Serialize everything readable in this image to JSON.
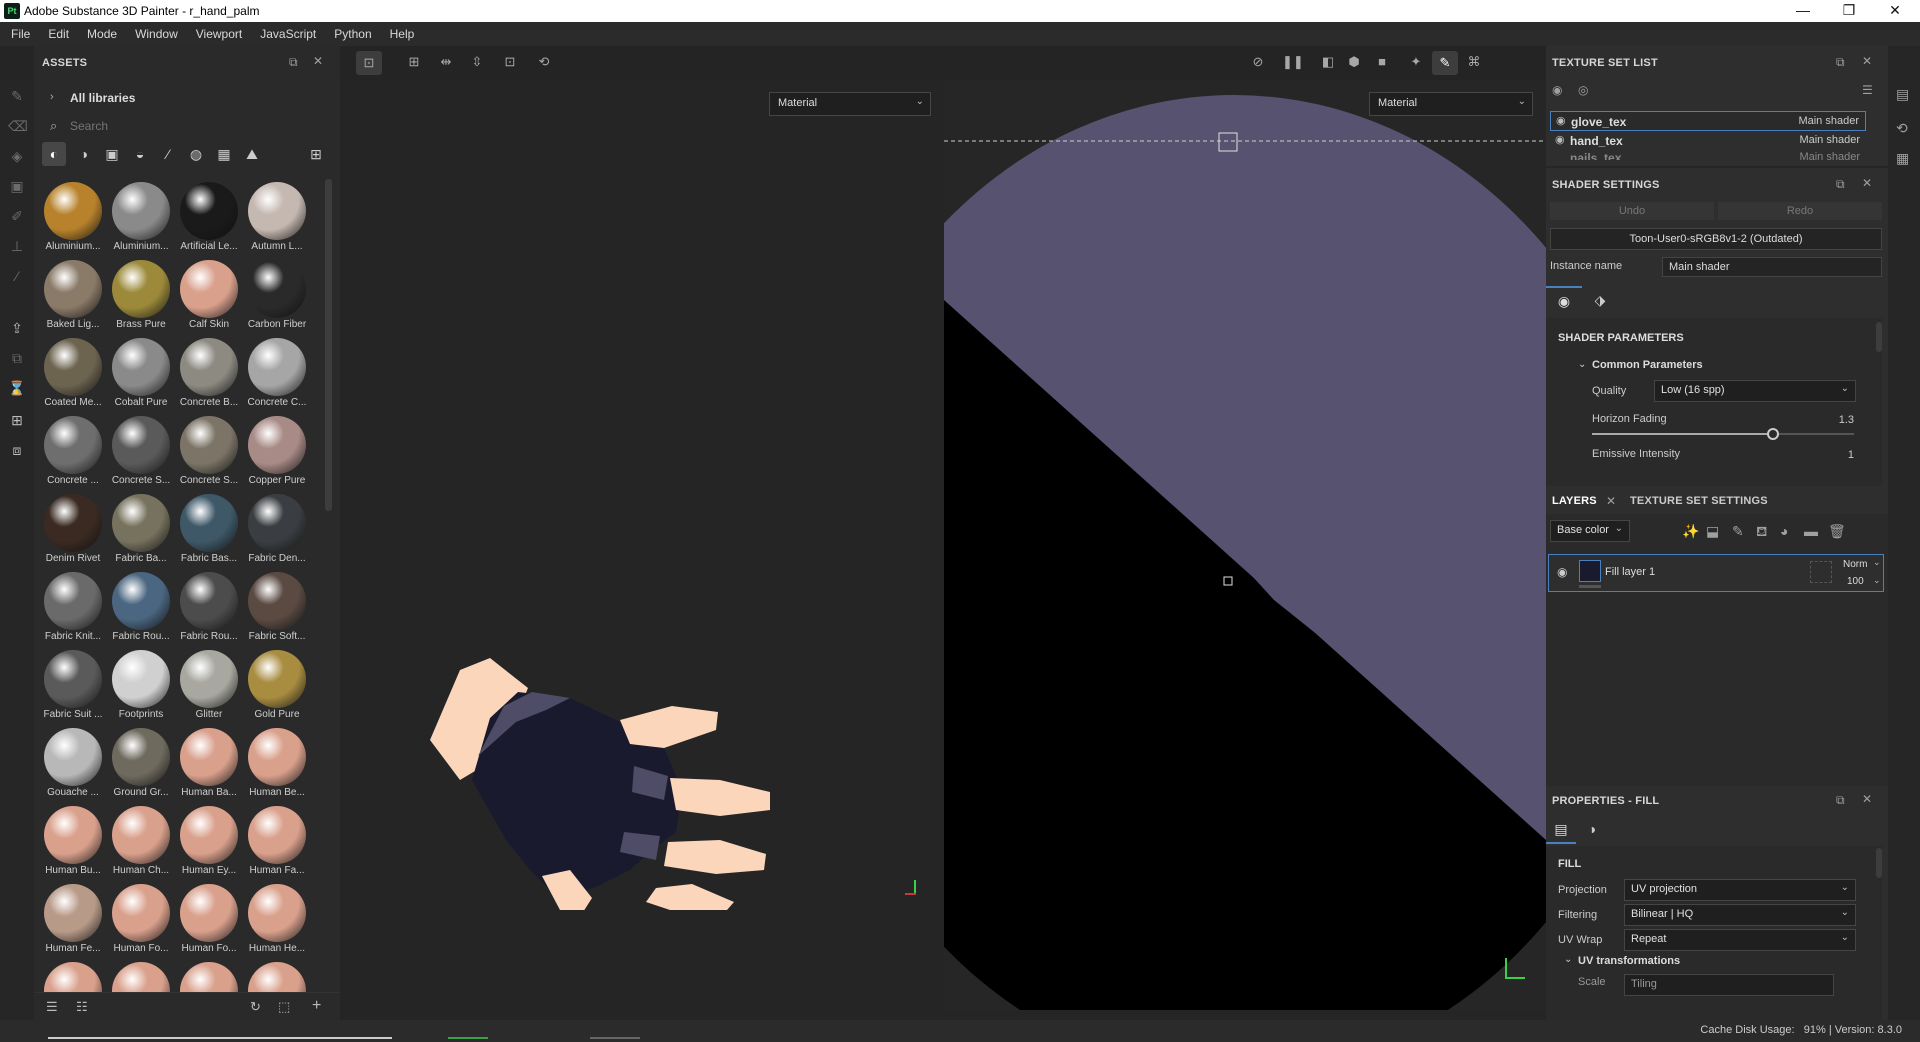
{
  "window": {
    "title": "Adobe Substance 3D Painter - r_hand_palm",
    "logo": "Pt",
    "minimize": "—",
    "maximize": "❐",
    "close": "✕"
  },
  "menu": [
    "File",
    "Edit",
    "Mode",
    "Window",
    "Viewport",
    "JavaScript",
    "Python",
    "Help"
  ],
  "assets": {
    "title": "ASSETS",
    "library": "All libraries",
    "search_placeholder": "Search",
    "items": [
      {
        "name": "Aluminium...",
        "color": "#b8822c"
      },
      {
        "name": "Aluminium...",
        "color": "#8a8a8a"
      },
      {
        "name": "Artificial Le...",
        "color": "#1a1a1a"
      },
      {
        "name": "Autumn L...",
        "color": "#c5b8b0"
      },
      {
        "name": "Baked Lig...",
        "color": "#8a7a68"
      },
      {
        "name": "Brass Pure",
        "color": "#9c8a3a"
      },
      {
        "name": "Calf Skin",
        "color": "#d9a08c"
      },
      {
        "name": "Carbon Fiber",
        "color": "#2a2a2a"
      },
      {
        "name": "Coated Me...",
        "color": "#6d6450"
      },
      {
        "name": "Cobalt Pure",
        "color": "#8a8a8a"
      },
      {
        "name": "Concrete B...",
        "color": "#8d8a82"
      },
      {
        "name": "Concrete C...",
        "color": "#a6a6a6"
      },
      {
        "name": "Concrete ...",
        "color": "#6e6e6e"
      },
      {
        "name": "Concrete S...",
        "color": "#5a5a5a"
      },
      {
        "name": "Concrete S...",
        "color": "#7c7466"
      },
      {
        "name": "Copper Pure",
        "color": "#a88a86"
      },
      {
        "name": "Denim Rivet",
        "color": "#3a2a22"
      },
      {
        "name": "Fabric Ba...",
        "color": "#77725e"
      },
      {
        "name": "Fabric Bas...",
        "color": "#3e5868"
      },
      {
        "name": "Fabric Den...",
        "color": "#3a3e42"
      },
      {
        "name": "Fabric Knit...",
        "color": "#6a6a6a"
      },
      {
        "name": "Fabric Rou...",
        "color": "#4a6680"
      },
      {
        "name": "Fabric Rou...",
        "color": "#4c4c4c"
      },
      {
        "name": "Fabric Soft...",
        "color": "#5a4a42"
      },
      {
        "name": "Fabric Suit ...",
        "color": "#5a5a5a"
      },
      {
        "name": "Footprints",
        "color": "#d0d0d0"
      },
      {
        "name": "Glitter",
        "color": "#a8a8a0"
      },
      {
        "name": "Gold Pure",
        "color": "#a88c40"
      },
      {
        "name": "Gouache ...",
        "color": "#b8b8b8"
      },
      {
        "name": "Ground Gr...",
        "color": "#6e6a5e"
      },
      {
        "name": "Human Ba...",
        "color": "#d9a08c"
      },
      {
        "name": "Human Be...",
        "color": "#d9a08c"
      },
      {
        "name": "Human Bu...",
        "color": "#d9a08c"
      },
      {
        "name": "Human Ch...",
        "color": "#d9a08c"
      },
      {
        "name": "Human Ey...",
        "color": "#d9a08c"
      },
      {
        "name": "Human Fa...",
        "color": "#d9a08c"
      },
      {
        "name": "Human Fe...",
        "color": "#b89a88"
      },
      {
        "name": "Human Fo...",
        "color": "#d9a08c"
      },
      {
        "name": "Human Fo...",
        "color": "#d9a08c"
      },
      {
        "name": "Human He...",
        "color": "#d9a08c"
      },
      {
        "name": "",
        "color": "#d9a08c"
      },
      {
        "name": "",
        "color": "#d9a08c"
      },
      {
        "name": "",
        "color": "#d9a08c"
      },
      {
        "name": "",
        "color": "#d9a08c"
      }
    ]
  },
  "viewport": {
    "left_channel": "Material",
    "right_channel": "Material",
    "model_colors": {
      "glove": "#1a1a2e",
      "skin": "#fbd6bb",
      "glove_edge": "#4e4c66",
      "uv_bg": "#575270"
    }
  },
  "texture_set_list": {
    "title": "TEXTURE SET LIST",
    "sets": [
      {
        "name": "glove_tex",
        "shader": "Main shader"
      },
      {
        "name": "hand_tex",
        "shader": "Main shader"
      },
      {
        "name": "nails_tex",
        "shader": "Main shader"
      }
    ]
  },
  "shader_settings": {
    "title": "SHADER SETTINGS",
    "undo": "Undo",
    "redo": "Redo",
    "shader": "Toon-User0-sRGB8v1-2 (Outdated)",
    "instance_label": "Instance name",
    "instance_value": "Main shader",
    "params_title": "SHADER PARAMETERS",
    "common_title": "Common Parameters",
    "quality_label": "Quality",
    "quality_value": "Low (16 spp)",
    "horizon_label": "Horizon Fading",
    "horizon_value": "1.3",
    "horizon_fraction": 0.69,
    "emissive_label": "Emissive Intensity",
    "emissive_value": "1"
  },
  "layers": {
    "tab_layers": "LAYERS",
    "tab_tss": "TEXTURE SET SETTINGS",
    "channel": "Base color",
    "layer_name": "Fill layer 1",
    "blend": "Norm",
    "opacity": "100"
  },
  "properties": {
    "title": "PROPERTIES - FILL",
    "section": "FILL",
    "projection_label": "Projection",
    "projection_value": "UV projection",
    "filtering_label": "Filtering",
    "filtering_value": "Bilinear | HQ",
    "uvwrap_label": "UV Wrap",
    "uvwrap_value": "Repeat",
    "uvtrans_title": "UV transformations",
    "scale_label": "Scale",
    "scale_value": "Tiling"
  },
  "status": {
    "cache": "Cache Disk Usage:   91% | Version: 8.3.0"
  }
}
